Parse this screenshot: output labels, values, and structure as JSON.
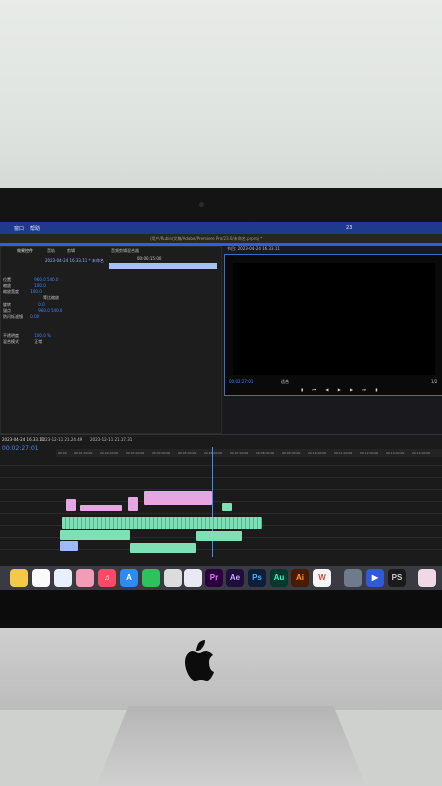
{
  "menubar": {
    "item1": "窗口",
    "item2": "帮助"
  },
  "titlebar": {
    "text": "/用户/Rubin/文稿/Adobe/Premiere Pro/23.0/未命名.prproj *"
  },
  "effects_panel": {
    "tabs": [
      "效果控件",
      "音轨",
      "剪辑",
      "音频剪辑混合器"
    ],
    "clip_name": "2023-04-24 16.33.11 * 未命名",
    "rows": [
      {
        "label": "位置",
        "v1": "960.0",
        "v2": "540.0"
      },
      {
        "label": "缩放",
        "v1": "100.0",
        "v2": ""
      },
      {
        "label": "缩放宽度",
        "v1": "100.0",
        "v2": ""
      },
      {
        "label": "等比缩放",
        "v1": "",
        "v2": ""
      },
      {
        "label": "旋转",
        "v1": "0.0",
        "v2": ""
      },
      {
        "label": "锚点",
        "v1": "960.0",
        "v2": "540.0"
      },
      {
        "label": "防闪烁滤镜",
        "v1": "0.00",
        "v2": ""
      },
      {
        "label": "不透明度",
        "v1": "100.0 %",
        "v2": ""
      },
      {
        "label": "混合模式",
        "v1": "正常",
        "v2": ""
      }
    ],
    "timecode": "00:00:15:00"
  },
  "program_monitor": {
    "title": "节目: 2023-04-24 16.33.11",
    "timecode": "00:02:27:01",
    "fit": "适合",
    "ratio": "1/2"
  },
  "timeline": {
    "sequence": "2023-04-24 16.33.11",
    "tab2": "2023-12-11 21.24.49",
    "tab3": "2023-12-11 21.17.31",
    "timecode": "00:02:27:01",
    "ruler": [
      "00:00",
      "00:01:00:00",
      "00:02:00:00",
      "00:03:00:00",
      "00:04:00:00",
      "00:05:00:00",
      "00:06:00:00",
      "00:07:00:00",
      "00:08:00:00",
      "00:09:00:00",
      "00:10:00:00",
      "00:11:00:00",
      "00:12:00:00",
      "00:13:00:00",
      "00:14:00:00"
    ]
  },
  "dock": [
    "Pr",
    "Ae",
    "Ps",
    "Au",
    "Ai"
  ],
  "colors": {
    "accent": "#2d62d8",
    "clip_video": "#e7a6e3",
    "clip_audio": "#7fe0b6"
  }
}
